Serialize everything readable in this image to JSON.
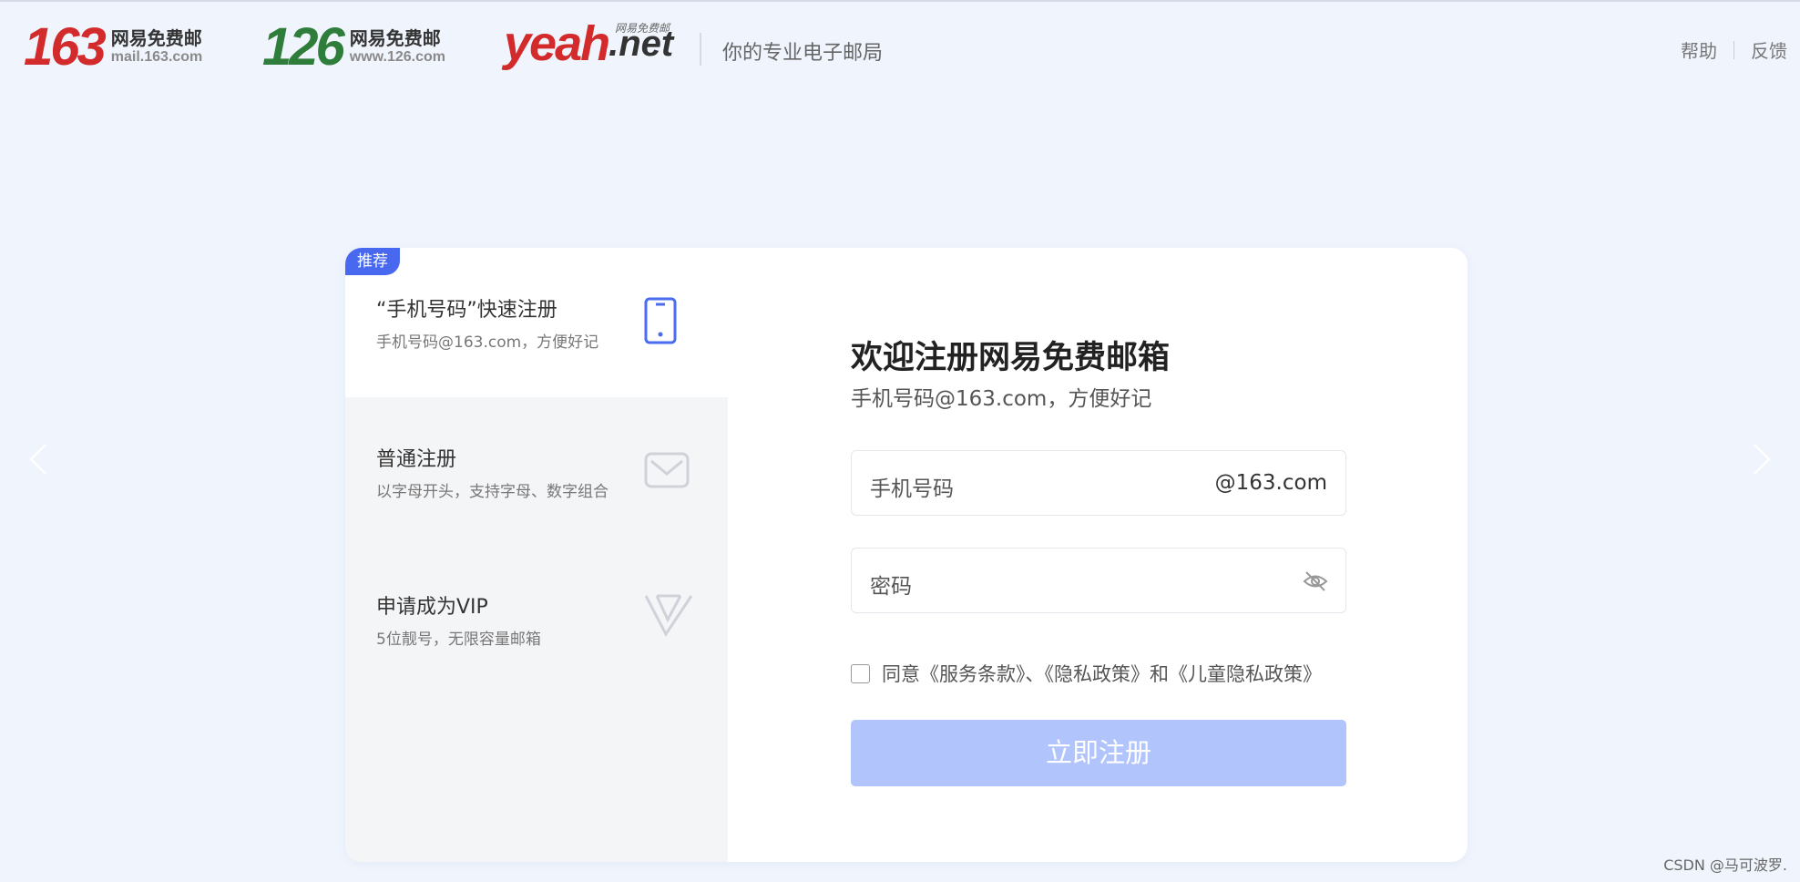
{
  "header": {
    "brands": [
      {
        "number": "163",
        "cn": "网易免费邮",
        "domain": "mail.163.com"
      },
      {
        "number": "126",
        "cn": "网易免费邮",
        "domain": "www.126.com"
      },
      {
        "word": "yeah",
        "suffix": ".net",
        "small": "网易免费邮"
      }
    ],
    "slogan": "你的专业电子邮局",
    "help": "帮助",
    "feedback": "反馈"
  },
  "sidebar": {
    "badge": "推荐",
    "options": [
      {
        "title": "“手机号码”快速注册",
        "desc": "手机号码@163.com，方便好记",
        "icon": "phone-icon"
      },
      {
        "title": "普通注册",
        "desc": "以字母开头，支持字母、数字组合",
        "icon": "mail-icon"
      },
      {
        "title": "申请成为VIP",
        "desc": "5位靓号，无限容量邮箱",
        "icon": "vip-icon"
      }
    ]
  },
  "form": {
    "title": "欢迎注册网易免费邮箱",
    "subtitle": "手机号码@163.com，方便好记",
    "phone_placeholder": "手机号码",
    "phone_suffix": "@163.com",
    "password_placeholder": "密码",
    "agreement": "同意《服务条款》、《隐私政策》和《儿童隐私政策》",
    "submit": "立即注册"
  },
  "watermark": "CSDN @马可波罗.",
  "colors": {
    "background": "#eff4fd",
    "accent": "#4868f0",
    "button_disabled": "#b1c4fb",
    "brand_red": "#d32b2b",
    "brand_green": "#2f7d3a"
  }
}
